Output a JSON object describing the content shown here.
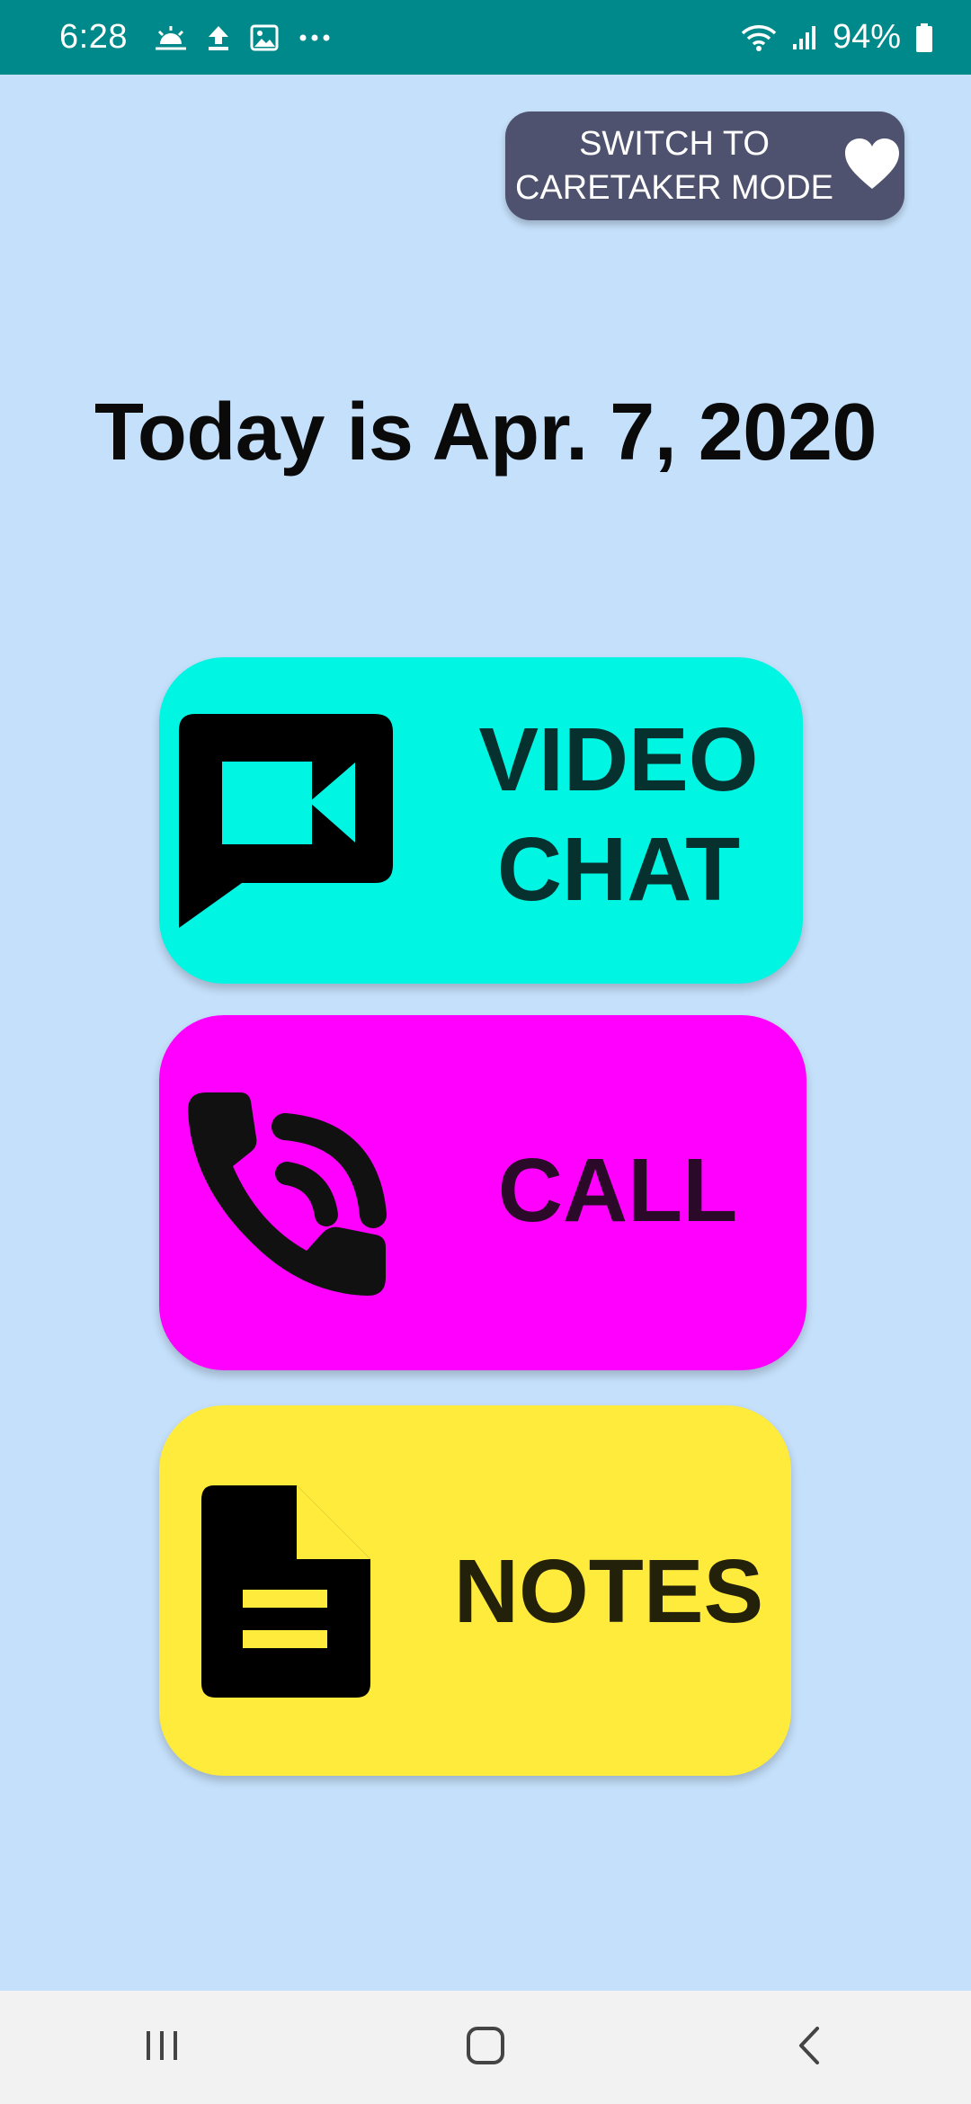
{
  "status_bar": {
    "time": "6:28",
    "battery_text": "94%",
    "left_icons": [
      "weather-icon",
      "upload-icon",
      "image-icon",
      "more-dots-icon"
    ],
    "right_icons": [
      "wifi-icon",
      "signal-icon",
      "battery-icon"
    ],
    "background_color": "#00898a"
  },
  "switch_mode": {
    "label": "SWITCH  TO\nCARETAKER MODE",
    "icon": "heart-icon",
    "background_color": "#4f526e"
  },
  "date_title": "Today is Apr. 7, 2020",
  "tiles": {
    "video_chat": {
      "label": "VIDEO\nCHAT",
      "icon": "video-chat-icon",
      "color": "#00f5e2"
    },
    "call": {
      "label": "CALL",
      "icon": "phone-call-icon",
      "color": "#ff00ff"
    },
    "notes": {
      "label": "NOTES",
      "icon": "notes-document-icon",
      "color": "#ffeb3b"
    }
  },
  "nav_bar": {
    "buttons": [
      "recent-apps-icon",
      "home-icon",
      "back-icon"
    ]
  },
  "background_color": "#c5e0fb"
}
